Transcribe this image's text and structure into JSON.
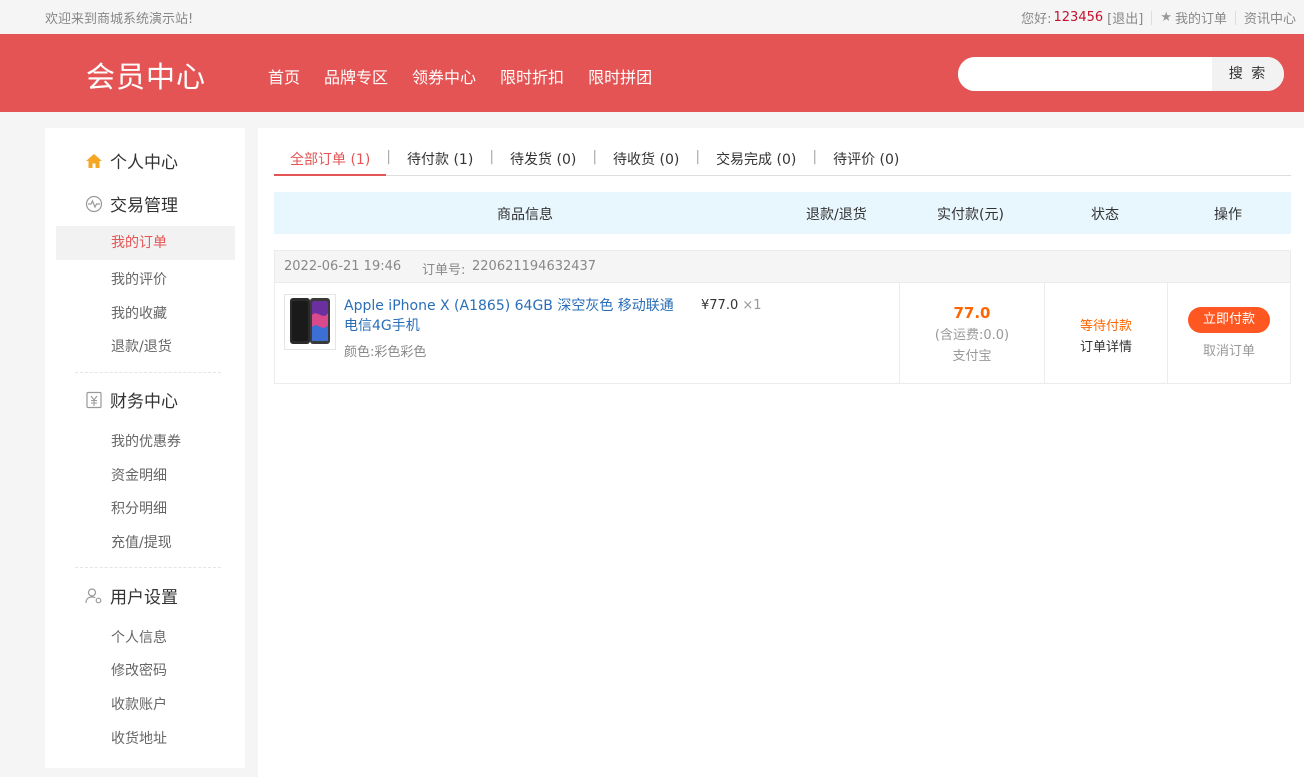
{
  "topbar": {
    "welcome": "欢迎来到商城系统演示站!",
    "greeting": "您好:",
    "username": "123456",
    "logout": "[退出]",
    "my_orders": "我的订单",
    "news_center": "资讯中心"
  },
  "header": {
    "title": "会员中心",
    "nav": [
      "首页",
      "品牌专区",
      "领券中心",
      "限时折扣",
      "限时拼团"
    ],
    "search_placeholder": "",
    "search_button": "搜 索",
    "accent_color": "#e55454"
  },
  "sidebar": {
    "personal_center": "个人中心",
    "trade": {
      "label": "交易管理",
      "items": [
        "我的订单",
        "我的评价",
        "我的收藏",
        "退款/退货"
      ]
    },
    "finance": {
      "label": "财务中心",
      "items": [
        "我的优惠券",
        "资金明细",
        "积分明细",
        "充值/提现"
      ]
    },
    "user": {
      "label": "用户设置",
      "items": [
        "个人信息",
        "修改密码",
        "收款账户",
        "收货地址"
      ]
    }
  },
  "tabs": [
    {
      "label": "全部订单",
      "count": "(1)"
    },
    {
      "label": "待付款",
      "count": "(1)"
    },
    {
      "label": "待发货",
      "count": "(0)"
    },
    {
      "label": "待收货",
      "count": "(0)"
    },
    {
      "label": "交易完成",
      "count": "(0)"
    },
    {
      "label": "待评价",
      "count": "(0)"
    }
  ],
  "table_headers": {
    "product": "商品信息",
    "refund": "退款/退货",
    "paid": "实付款(元)",
    "status": "状态",
    "action": "操作"
  },
  "order": {
    "time": "2022-06-21 19:46",
    "order_no_label": "订单号:",
    "order_no": "220621194632437",
    "product_name": "Apple iPhone X (A1865) 64GB 深空灰色 移动联通电信4G手机",
    "color_label": "颜色:",
    "color_value": "彩色彩色",
    "unit_price": "¥77.0",
    "quantity": "×1",
    "amount": "77.0",
    "shipping": "(含运费:0.0)",
    "payment_method": "支付宝",
    "status": "等待付款",
    "detail_link": "订单详情",
    "pay_button": "立即付款",
    "cancel_link": "取消订单"
  }
}
